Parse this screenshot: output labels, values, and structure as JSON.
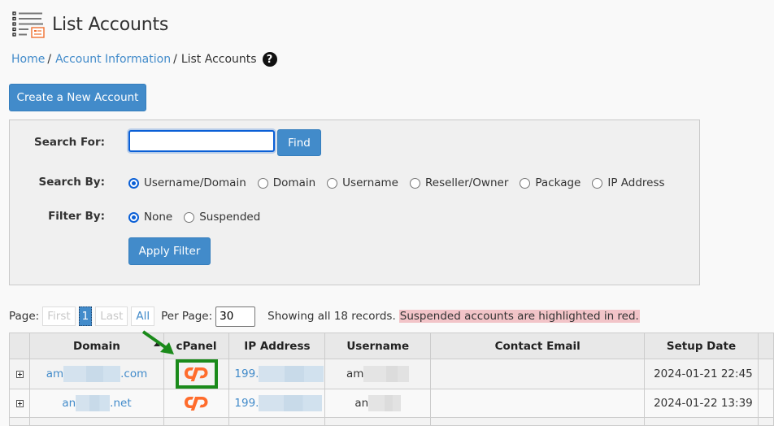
{
  "header": {
    "title": "List Accounts",
    "icon": "list-accounts-icon"
  },
  "breadcrumb": {
    "items": [
      {
        "label": "Home",
        "link": true
      },
      {
        "label": "Account Information",
        "link": true
      },
      {
        "label": "List Accounts",
        "link": false
      }
    ],
    "separator": "/",
    "help_icon": "?"
  },
  "actions": {
    "create_label": "Create a New Account"
  },
  "search": {
    "search_for_label": "Search For:",
    "query_value": "",
    "find_label": "Find",
    "search_by_label": "Search By:",
    "search_by_options": [
      {
        "label": "Username/Domain",
        "checked": true
      },
      {
        "label": "Domain",
        "checked": false
      },
      {
        "label": "Username",
        "checked": false
      },
      {
        "label": "Reseller/Owner",
        "checked": false
      },
      {
        "label": "Package",
        "checked": false
      },
      {
        "label": "IP Address",
        "checked": false
      }
    ],
    "filter_by_label": "Filter By:",
    "filter_by_options": [
      {
        "label": "None",
        "checked": true
      },
      {
        "label": "Suspended",
        "checked": false
      }
    ],
    "apply_label": "Apply Filter"
  },
  "pagination": {
    "page_label": "Page:",
    "first_label": "First",
    "current_page": "1",
    "last_label": "Last",
    "all_label": "All",
    "per_page_label": "Per Page:",
    "per_page_value": "30",
    "records_text": "Showing all 18 records.",
    "suspended_note": "Suspended accounts are highlighted in red."
  },
  "table": {
    "columns": [
      "",
      "Domain",
      "cPanel",
      "IP Address",
      "Username",
      "Contact Email",
      "Setup Date"
    ],
    "rows": [
      {
        "domain_prefix": "am",
        "domain_suffix": ".com",
        "ip_prefix": "199.",
        "username_prefix": "am",
        "contact_email": "",
        "setup_date": "2024-01-21 22:45",
        "cpanel_highlighted": true
      },
      {
        "domain_prefix": "an",
        "domain_suffix": ".net",
        "ip_prefix": "199.",
        "username_prefix": "an",
        "contact_email": "",
        "setup_date": "2024-01-22 13:39",
        "cpanel_highlighted": false
      }
    ]
  },
  "colors": {
    "primary": "#428bca",
    "cpanel_orange": "#ff6c2c",
    "annotation_green": "#1a8a1a",
    "suspended_highlight": "#f2c4c8"
  }
}
